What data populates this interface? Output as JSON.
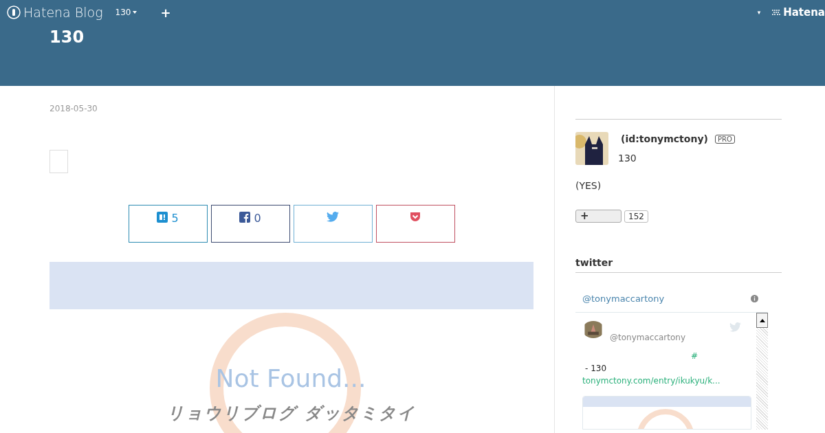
{
  "header": {
    "logo": "Hatena Blog",
    "blog_menu": "130",
    "add": "+",
    "account_caret": "▾",
    "hatena_logo": "Hatena",
    "blog_title": "130"
  },
  "entry": {
    "date": "2018-05-30",
    "share_buttons": [
      {
        "kind": "hatena",
        "count": "5"
      },
      {
        "kind": "facebook",
        "count": "0"
      },
      {
        "kind": "twitter"
      },
      {
        "kind": "pocket"
      }
    ],
    "not_found_image": {
      "title": "Not Found...",
      "subtitle": "リョウリブログ ダッタミタイ"
    }
  },
  "sidebar": {
    "profile": {
      "name": "(id:tonymctony)",
      "badge": "PRO",
      "blog": "130",
      "description": "(YES)",
      "follow": "+",
      "followers": "152"
    },
    "twitter": {
      "heading": "twitter",
      "account": "@tonymaccartony",
      "tweet": {
        "handle": "@tonymaccartony",
        "hashtag": "#",
        "text": "- 130",
        "link": "tonymctony.com/entry/ikukyu/k..."
      }
    }
  }
}
